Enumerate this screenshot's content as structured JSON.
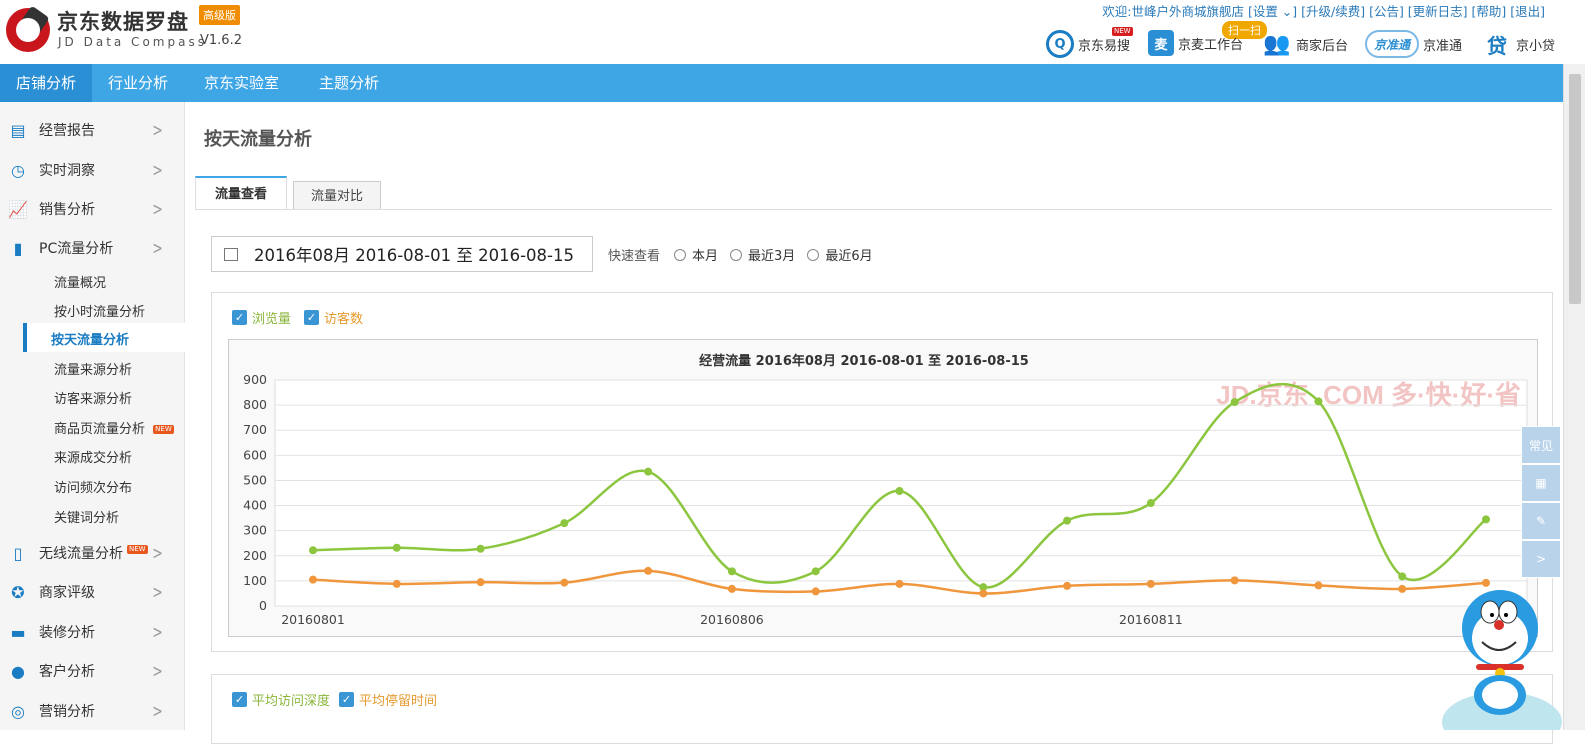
{
  "header": {
    "logo_title": "京东数据罗盘",
    "logo_badge": "高级版",
    "logo_subtitle": "JD Data Compass",
    "version": "V1.6.2",
    "welcome_line": "欢迎:世峰户外商城旗舰店 [设置 ⌄] [升级/续费] [公告] [更新日志] [帮助] [退出]",
    "scan_badge": "扫一扫",
    "new_tag": "NEW",
    "quick_links": [
      "京东易搜",
      "京麦工作台",
      "商家后台",
      "京准通",
      "京小贷"
    ]
  },
  "topnav": [
    "店铺分析",
    "行业分析",
    "京东实验室",
    "主题分析"
  ],
  "sidebar": {
    "groups": [
      "经营报告",
      "实时洞察",
      "销售分析",
      "PC流量分析",
      "无线流量分析",
      "商家评级",
      "装修分析",
      "客户分析",
      "营销分析"
    ],
    "pc_sub": [
      "流量概况",
      "按小时流量分析",
      "按天流量分析",
      "流量来源分析",
      "访客来源分析",
      "商品页流量分析",
      "来源成交分析",
      "访问频次分布",
      "关键词分析"
    ],
    "new_tag": "NEW"
  },
  "main": {
    "title": "按天流量分析",
    "tabs": [
      "流量查看",
      "流量对比"
    ],
    "date_range": "2016年08月 2016-08-01 至 2016-08-15",
    "quick_label": "快速查看",
    "quick_options": [
      "本月",
      "最近3月",
      "最近6月"
    ],
    "legend1": [
      "浏览量",
      "访客数"
    ],
    "legend2": [
      "平均访问深度",
      "平均停留时间"
    ]
  },
  "side_tools": {
    "faq": "常见"
  },
  "colors": {
    "accent": "#3fa6e5",
    "pv": "#8cc63f",
    "uv": "#f0963c",
    "legend_green": "#8ab53c",
    "legend_orange": "#e69a2e"
  },
  "chart_data": {
    "type": "line",
    "title": "经营流量  2016年08月 2016-08-01 至 2016-08-15",
    "x": [
      "20160801",
      "20160802",
      "20160803",
      "20160804",
      "20160805",
      "20160806",
      "20160807",
      "20160808",
      "20160809",
      "20160810",
      "20160811",
      "20160812",
      "20160813",
      "20160814",
      "20160815"
    ],
    "x_tick_labels": [
      "20160801",
      "20160806",
      "20160811"
    ],
    "series": [
      {
        "name": "浏览量",
        "values": [
          222,
          232,
          228,
          330,
          535,
          138,
          138,
          458,
          75,
          340,
          410,
          812,
          815,
          118,
          345
        ]
      },
      {
        "name": "访客数",
        "values": [
          105,
          88,
          95,
          93,
          140,
          68,
          58,
          88,
          50,
          80,
          88,
          102,
          82,
          68,
          92
        ]
      }
    ],
    "ylim": [
      0,
      900
    ],
    "yticks": [
      0,
      100,
      200,
      300,
      400,
      500,
      600,
      700,
      800,
      900
    ],
    "grid": true,
    "watermark": "JD.京东 .COM 多·快·好·省"
  }
}
